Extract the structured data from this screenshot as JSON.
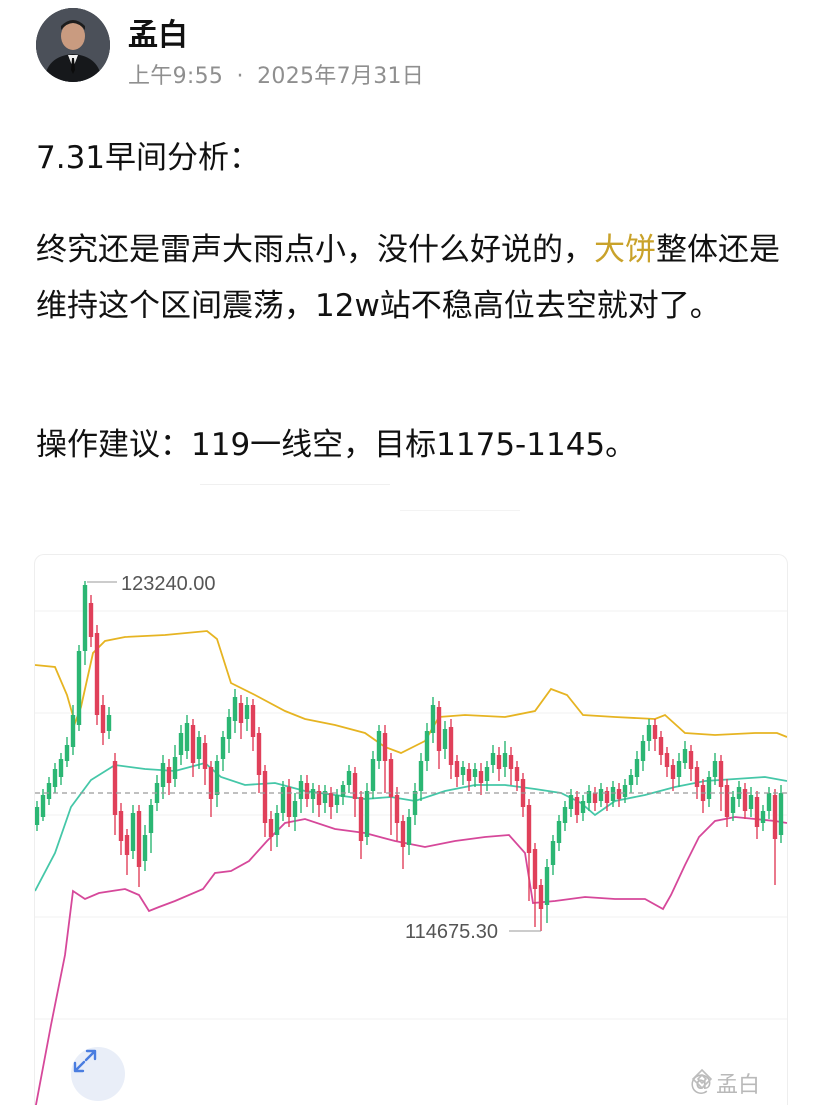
{
  "author": {
    "name": "孟白",
    "time": "上午9:55",
    "separator": "·",
    "date": "2025年7月31日"
  },
  "post": {
    "title": "7.31早间分析：",
    "body_before": "终究还是雷声大雨点小，没什么好说的，",
    "body_highlight": "大饼",
    "body_after": "整体还是维持这个区间震荡，12w站不稳高位去空就对了。",
    "suggestion": "操作建议：119一线空，目标1175-1145。"
  },
  "chart": {
    "high_label": "123240.00",
    "low_label": "114675.30",
    "watermark_symbol": "@",
    "watermark_name": "孟白",
    "colors": {
      "up": "#2bb673",
      "down": "#e0405a",
      "upper_band": "#e6b422",
      "middle_band": "#45c7a8",
      "lower_band": "#d6489a",
      "price_line": "#9a9a9a"
    }
  },
  "chart_data": {
    "type": "candlestick",
    "marked_high": 123240.0,
    "marked_low": 114675.3,
    "bands": [
      "upper",
      "middle",
      "lower"
    ]
  },
  "icons": {
    "expand": "expand-arrows-icon",
    "watermark": "coin-logo-icon"
  }
}
